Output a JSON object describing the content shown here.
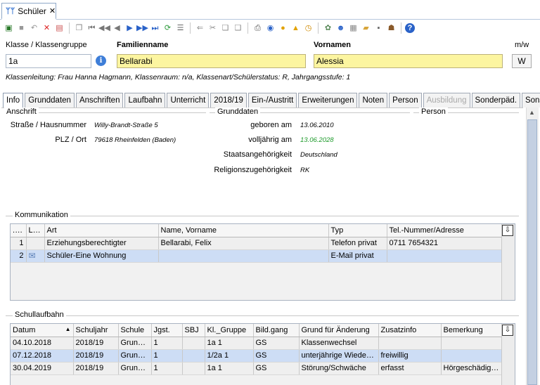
{
  "tab": {
    "title": "Schüler",
    "close": "✕"
  },
  "toolbar": {
    "icons": [
      "new-icon",
      "save-icon",
      "undo-icon",
      "delete-icon",
      "card-icon",
      "copy-doc-icon",
      "first-icon",
      "prev-page-icon",
      "prev-icon",
      "next-icon",
      "next-page-icon",
      "last-icon",
      "refresh-icon",
      "list-icon",
      "back-arrow-icon",
      "cut-icon",
      "paste-icon",
      "clipboard-icon",
      "print-icon",
      "view-icon",
      "bulb-icon",
      "bell-icon",
      "clock-icon",
      "settings-icon",
      "person-icon",
      "group-icon",
      "folder-icon",
      "chat-icon",
      "id-icon",
      "help-icon"
    ]
  },
  "header": {
    "class_label": "Klasse / Klassengruppe",
    "class_value": "1a",
    "lastname_label": "Familienname",
    "lastname_value": "Bellarabi",
    "firstname_label": "Vornamen",
    "firstname_value": "Alessia",
    "gender_label": "m/w",
    "gender_value": "W",
    "info": "Klassenleitung: Frau Hanna Hagmann, Klassenraum: n/a, Klassenart/Schülerstatus: R, Jahrgangsstufe: 1"
  },
  "subtabs": [
    "Info",
    "Grunddaten",
    "Anschriften",
    "Laufbahn",
    "Unterricht",
    "2018/19",
    "Ein-/Austritt",
    "Erweiterungen",
    "Noten",
    "Person",
    "Ausbildung",
    "Sonderpäd.",
    "Sonstiges"
  ],
  "anschrift": {
    "title": "Anschrift",
    "street_label": "Straße / Hausnummer",
    "street_value": "Willy-Brandt-Straße 5",
    "plz_label": "PLZ / Ort",
    "plz_value": "79618 Rheinfelden (Baden)"
  },
  "grunddaten": {
    "title": "Grunddaten",
    "birth_label": "geboren am",
    "birth_value": "13.06.2010",
    "adult_label": "volljährig am",
    "adult_value": "13.06.2028",
    "nat_label": "Staatsangehörigkeit",
    "nat_value": "Deutschland",
    "rel_label": "Religionszugehörigkeit",
    "rel_value": "RK"
  },
  "person": {
    "title": "Person"
  },
  "kommunikation": {
    "title": "Kommunikation",
    "columns": [
      "...",
      "Link",
      "Art",
      "Name, Vorname",
      "Typ",
      "Tel.-Nummer/Adresse"
    ],
    "rows": [
      {
        "n": "1",
        "art": "Erziehungsberechtigter",
        "name": "Bellarabi, Felix",
        "typ": "Telefon privat",
        "tel": "0711 7654321"
      },
      {
        "n": "2",
        "art": "Schüler-Eine Wohnung",
        "name": "",
        "typ": "E-Mail privat",
        "tel": ""
      }
    ]
  },
  "schullaufbahn": {
    "title": "Schullaufbahn",
    "columns": [
      "Datum",
      "Schuljahr",
      "Schule",
      "Jgst.",
      "SBJ",
      "Kl._Gruppe",
      "Bild.gang",
      "Grund für Änderung",
      "Zusatzinfo",
      "Bemerkung"
    ],
    "rows": [
      {
        "datum": "04.10.2018",
        "sj": "2018/19",
        "schule": "Grunds...",
        "jgst": "1",
        "sbj": "",
        "kl": "1a 1",
        "bg": "GS",
        "grund": "Klassenwechsel",
        "zusatz": "",
        "bem": ""
      },
      {
        "datum": "07.12.2018",
        "sj": "2018/19",
        "schule": "Grunds...",
        "jgst": "1",
        "sbj": "",
        "kl": "1/2a 1",
        "bg": "GS",
        "grund": "unterjährige Wiederh...",
        "zusatz": "freiwillig",
        "bem": ""
      },
      {
        "datum": "30.04.2019",
        "sj": "2018/19",
        "schule": "Grunds...",
        "jgst": "1",
        "sbj": "",
        "kl": "1a 1",
        "bg": "GS",
        "grund": "Störung/Schwäche",
        "zusatz": "erfasst",
        "bem": "Hörgeschädigt ..."
      }
    ]
  }
}
